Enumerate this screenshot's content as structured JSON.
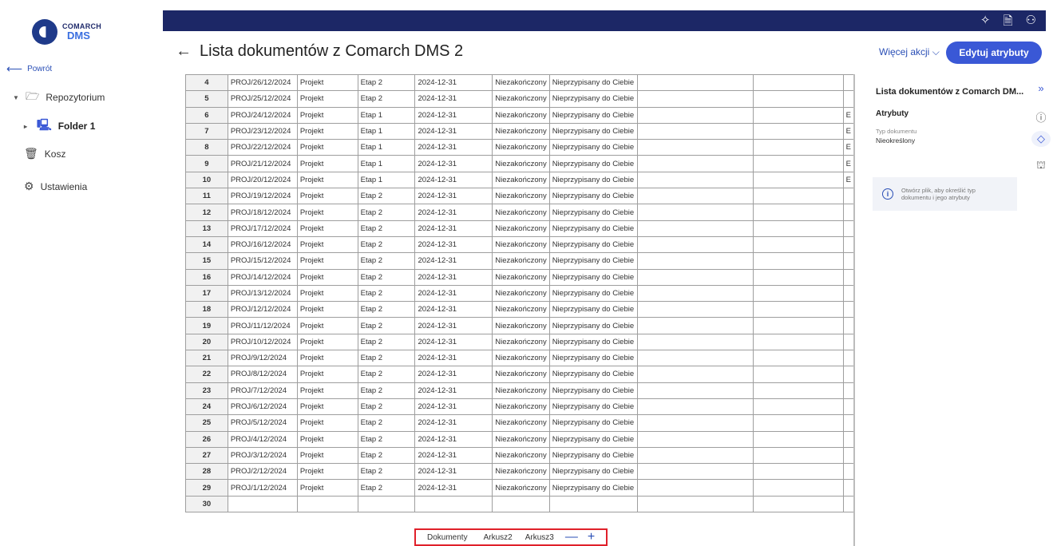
{
  "brand": {
    "line1": "COMARCH",
    "line2": "DMS"
  },
  "sidebar": {
    "back_label": "Powrót",
    "items": [
      {
        "label": "Repozytorium"
      },
      {
        "label": "Folder 1"
      },
      {
        "label": "Kosz"
      },
      {
        "label": "Ustawienia"
      }
    ]
  },
  "topbar": {
    "icons": [
      "sparkle-icon",
      "document-clock-icon",
      "user-icon"
    ]
  },
  "header": {
    "title": "Lista dokumentów z Comarch DMS 2",
    "more_actions": "Więcej akcji",
    "edit_button": "Edytuj atrybuty"
  },
  "sheet": {
    "rows": [
      {
        "n": "4",
        "id": "PROJ/26/12/2024",
        "type": "Projekt",
        "stage": "Etap 2",
        "date": "2024-12-31",
        "status": "Niezakończony",
        "assign": "Nieprzypisany do Ciebie",
        "extra": ""
      },
      {
        "n": "5",
        "id": "PROJ/25/12/2024",
        "type": "Projekt",
        "stage": "Etap 2",
        "date": "2024-12-31",
        "status": "Niezakończony",
        "assign": "Nieprzypisany do Ciebie",
        "extra": ""
      },
      {
        "n": "6",
        "id": "PROJ/24/12/2024",
        "type": "Projekt",
        "stage": "Etap 1",
        "date": "2024-12-31",
        "status": "Niezakończony",
        "assign": "Nieprzypisany do Ciebie",
        "extra": "E"
      },
      {
        "n": "7",
        "id": "PROJ/23/12/2024",
        "type": "Projekt",
        "stage": "Etap 1",
        "date": "2024-12-31",
        "status": "Niezakończony",
        "assign": "Nieprzypisany do Ciebie",
        "extra": "E"
      },
      {
        "n": "8",
        "id": "PROJ/22/12/2024",
        "type": "Projekt",
        "stage": "Etap 1",
        "date": "2024-12-31",
        "status": "Niezakończony",
        "assign": "Nieprzypisany do Ciebie",
        "extra": "E"
      },
      {
        "n": "9",
        "id": "PROJ/21/12/2024",
        "type": "Projekt",
        "stage": "Etap 1",
        "date": "2024-12-31",
        "status": "Niezakończony",
        "assign": "Nieprzypisany do Ciebie",
        "extra": "E"
      },
      {
        "n": "10",
        "id": "PROJ/20/12/2024",
        "type": "Projekt",
        "stage": "Etap 1",
        "date": "2024-12-31",
        "status": "Niezakończony",
        "assign": "Nieprzypisany do Ciebie",
        "extra": "E"
      },
      {
        "n": "11",
        "id": "PROJ/19/12/2024",
        "type": "Projekt",
        "stage": "Etap 2",
        "date": "2024-12-31",
        "status": "Niezakończony",
        "assign": "Nieprzypisany do Ciebie",
        "extra": ""
      },
      {
        "n": "12",
        "id": "PROJ/18/12/2024",
        "type": "Projekt",
        "stage": "Etap 2",
        "date": "2024-12-31",
        "status": "Niezakończony",
        "assign": "Nieprzypisany do Ciebie",
        "extra": ""
      },
      {
        "n": "13",
        "id": "PROJ/17/12/2024",
        "type": "Projekt",
        "stage": "Etap 2",
        "date": "2024-12-31",
        "status": "Niezakończony",
        "assign": "Nieprzypisany do Ciebie",
        "extra": ""
      },
      {
        "n": "14",
        "id": "PROJ/16/12/2024",
        "type": "Projekt",
        "stage": "Etap 2",
        "date": "2024-12-31",
        "status": "Niezakończony",
        "assign": "Nieprzypisany do Ciebie",
        "extra": ""
      },
      {
        "n": "15",
        "id": "PROJ/15/12/2024",
        "type": "Projekt",
        "stage": "Etap 2",
        "date": "2024-12-31",
        "status": "Niezakończony",
        "assign": "Nieprzypisany do Ciebie",
        "extra": ""
      },
      {
        "n": "16",
        "id": "PROJ/14/12/2024",
        "type": "Projekt",
        "stage": "Etap 2",
        "date": "2024-12-31",
        "status": "Niezakończony",
        "assign": "Nieprzypisany do Ciebie",
        "extra": ""
      },
      {
        "n": "17",
        "id": "PROJ/13/12/2024",
        "type": "Projekt",
        "stage": "Etap 2",
        "date": "2024-12-31",
        "status": "Niezakończony",
        "assign": "Nieprzypisany do Ciebie",
        "extra": ""
      },
      {
        "n": "18",
        "id": "PROJ/12/12/2024",
        "type": "Projekt",
        "stage": "Etap 2",
        "date": "2024-12-31",
        "status": "Niezakończony",
        "assign": "Nieprzypisany do Ciebie",
        "extra": ""
      },
      {
        "n": "19",
        "id": "PROJ/11/12/2024",
        "type": "Projekt",
        "stage": "Etap 2",
        "date": "2024-12-31",
        "status": "Niezakończony",
        "assign": "Nieprzypisany do Ciebie",
        "extra": ""
      },
      {
        "n": "20",
        "id": "PROJ/10/12/2024",
        "type": "Projekt",
        "stage": "Etap 2",
        "date": "2024-12-31",
        "status": "Niezakończony",
        "assign": "Nieprzypisany do Ciebie",
        "extra": ""
      },
      {
        "n": "21",
        "id": "PROJ/9/12/2024",
        "type": "Projekt",
        "stage": "Etap 2",
        "date": "2024-12-31",
        "status": "Niezakończony",
        "assign": "Nieprzypisany do Ciebie",
        "extra": ""
      },
      {
        "n": "22",
        "id": "PROJ/8/12/2024",
        "type": "Projekt",
        "stage": "Etap 2",
        "date": "2024-12-31",
        "status": "Niezakończony",
        "assign": "Nieprzypisany do Ciebie",
        "extra": ""
      },
      {
        "n": "23",
        "id": "PROJ/7/12/2024",
        "type": "Projekt",
        "stage": "Etap 2",
        "date": "2024-12-31",
        "status": "Niezakończony",
        "assign": "Nieprzypisany do Ciebie",
        "extra": ""
      },
      {
        "n": "24",
        "id": "PROJ/6/12/2024",
        "type": "Projekt",
        "stage": "Etap 2",
        "date": "2024-12-31",
        "status": "Niezakończony",
        "assign": "Nieprzypisany do Ciebie",
        "extra": ""
      },
      {
        "n": "25",
        "id": "PROJ/5/12/2024",
        "type": "Projekt",
        "stage": "Etap 2",
        "date": "2024-12-31",
        "status": "Niezakończony",
        "assign": "Nieprzypisany do Ciebie",
        "extra": ""
      },
      {
        "n": "26",
        "id": "PROJ/4/12/2024",
        "type": "Projekt",
        "stage": "Etap 2",
        "date": "2024-12-31",
        "status": "Niezakończony",
        "assign": "Nieprzypisany do Ciebie",
        "extra": ""
      },
      {
        "n": "27",
        "id": "PROJ/3/12/2024",
        "type": "Projekt",
        "stage": "Etap 2",
        "date": "2024-12-31",
        "status": "Niezakończony",
        "assign": "Nieprzypisany do Ciebie",
        "extra": ""
      },
      {
        "n": "28",
        "id": "PROJ/2/12/2024",
        "type": "Projekt",
        "stage": "Etap 2",
        "date": "2024-12-31",
        "status": "Niezakończony",
        "assign": "Nieprzypisany do Ciebie",
        "extra": ""
      },
      {
        "n": "29",
        "id": "PROJ/1/12/2024",
        "type": "Projekt",
        "stage": "Etap 2",
        "date": "2024-12-31",
        "status": "Niezakończony",
        "assign": "Nieprzypisany do Ciebie",
        "extra": ""
      },
      {
        "n": "30",
        "id": "",
        "type": "",
        "stage": "",
        "date": "",
        "status": "",
        "assign": "",
        "extra": ""
      }
    ],
    "tabs": [
      "Dokumenty",
      "Arkusz2",
      "Arkusz3"
    ],
    "tab_remove": "—",
    "tab_add": "+"
  },
  "panel": {
    "title": "Lista dokumentów z Comarch DM...",
    "attributes_heading": "Atrybuty",
    "type_label": "Typ dokumentu",
    "type_value": "Nieokreślony",
    "info_text": "Otwórz plik, aby określić typ dokumentu i jego atrybuty"
  },
  "colors": {
    "topbar": "#1c2766",
    "accent": "#3a58d6",
    "highlight": "#e0202a"
  }
}
